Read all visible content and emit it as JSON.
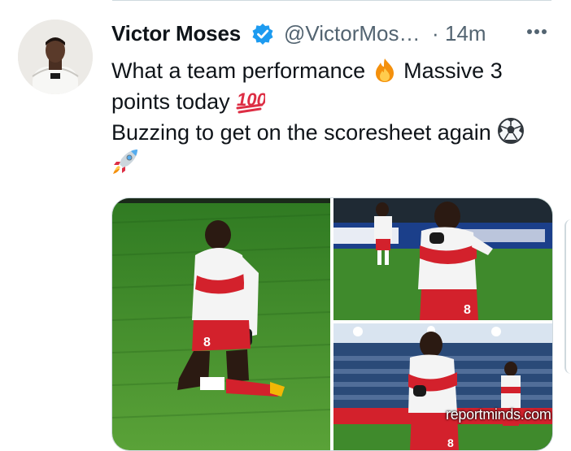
{
  "tweet": {
    "author_name": "Victor Moses",
    "handle": "@VictorMos…",
    "separator": "·",
    "time": "14m",
    "lines": [
      "What a team performance",
      "Massive 3",
      "points today",
      "Buzzing to get on the scoresheet again"
    ],
    "emojis": [
      "fire-emoji",
      "hundred-points-emoji",
      "soccer-ball-emoji",
      "rocket-emoji"
    ]
  },
  "media": {
    "photos": [
      "player-kneeling-celebration",
      "player-running-celebration",
      "player-walking-stadium"
    ],
    "watermark": "reportminds.com",
    "shirt_number": "8"
  },
  "colors": {
    "verified_blue": "#1d9bf0",
    "secondary_text": "#536471",
    "pitch_green": "#3f8a2c",
    "kit_red": "#d3212c"
  }
}
